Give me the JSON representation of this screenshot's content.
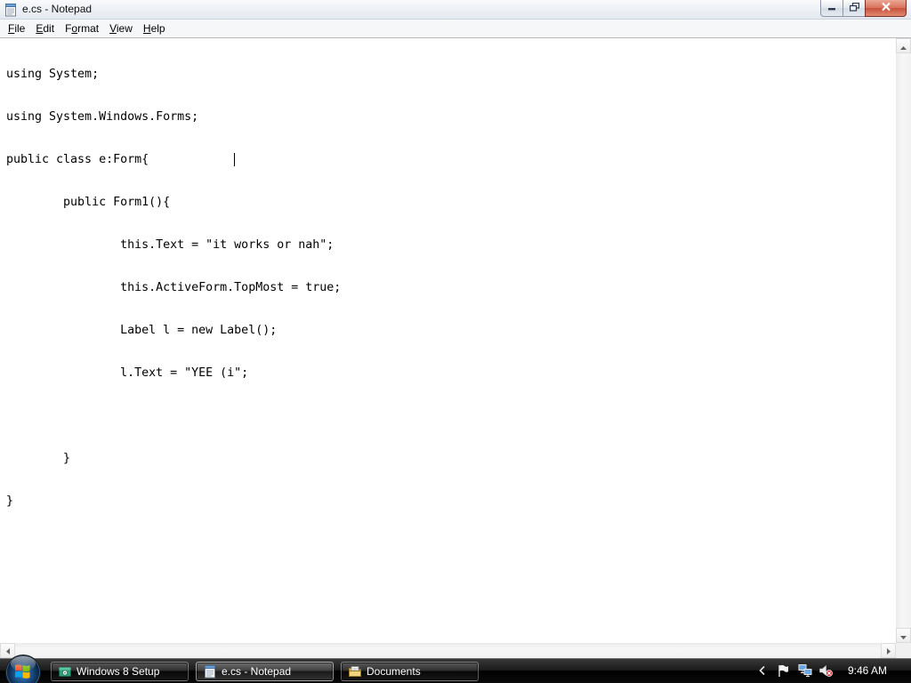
{
  "window": {
    "title": "e.cs - Notepad",
    "app_icon": "notepad-icon",
    "controls": {
      "minimize": "minimize-icon",
      "restore": "restore-icon",
      "close": "close-icon"
    }
  },
  "menu": {
    "items": [
      {
        "label": "File",
        "mnemonic": "F"
      },
      {
        "label": "Edit",
        "mnemonic": "E"
      },
      {
        "label": "Format",
        "mnemonic": "o"
      },
      {
        "label": "View",
        "mnemonic": "V"
      },
      {
        "label": "Help",
        "mnemonic": "H"
      }
    ]
  },
  "editor": {
    "lines": [
      "using System;",
      "using System.Windows.Forms;",
      "public class e:Form{",
      "\tpublic Form1(){",
      "\t\tthis.Text = \"it works or nah\";",
      "\t\tthis.ActiveForm.TopMost = true;",
      "\t\tLabel l = new Label();",
      "\t\tl.Text = \"YEE (i\";",
      "",
      "\t}",
      "}"
    ]
  },
  "taskbar": {
    "start_icon": "windows-orb-icon",
    "buttons": [
      {
        "label": "Windows 8 Setup",
        "icon": "setup-icon",
        "active": false
      },
      {
        "label": "e.cs - Notepad",
        "icon": "notepad-icon",
        "active": true
      },
      {
        "label": "Documents",
        "icon": "documents-icon",
        "active": false
      }
    ],
    "tray": {
      "icons": [
        "show-hidden-icons-chevron-icon",
        "action-center-flag-icon",
        "network-icon",
        "volume-muted-icon"
      ],
      "clock": "9:46 AM"
    }
  },
  "colors": {
    "close_button": "#c8513b",
    "taskbar": "#000000",
    "editor_background": "#ffffff"
  }
}
